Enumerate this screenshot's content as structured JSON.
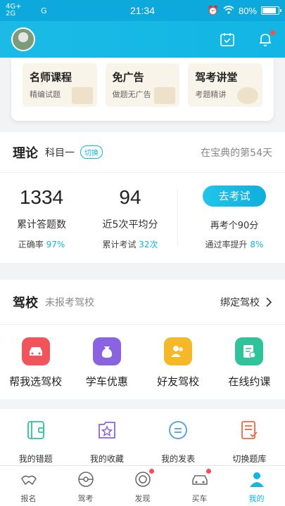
{
  "status": {
    "net1": "4G+",
    "net2": "2G",
    "net3": "G",
    "time": "21:34",
    "battery": "80%"
  },
  "promo": [
    {
      "title": "名师课程",
      "subtitle": "精编试题"
    },
    {
      "title": "免广告",
      "subtitle": "做题无广告"
    },
    {
      "title": "驾考讲堂",
      "subtitle": "考题精讲"
    }
  ],
  "theory": {
    "title": "理论",
    "subject": "科目一",
    "switch_label": "切换",
    "days_text": "在宝典的第54天",
    "total_answered": "1334",
    "total_label": "累计答题数",
    "accuracy_label": "正确率",
    "accuracy_value": "97%",
    "avg_score": "94",
    "avg_label": "近5次平均分",
    "exams_label": "累计考试",
    "exams_value": "32次",
    "exam_button": "去考试",
    "exam_note": "再考个90分",
    "pass_label": "通过率提升",
    "pass_value": "8%"
  },
  "school": {
    "title": "驾校",
    "status": "未报考驾校",
    "bind_label": "绑定驾校",
    "items": [
      {
        "label": "帮我选驾校",
        "color": "#f2545b"
      },
      {
        "label": "学车优惠",
        "color": "#8a63e0"
      },
      {
        "label": "好友驾校",
        "color": "#f5b829"
      },
      {
        "label": "在线约课",
        "color": "#2ec39a"
      }
    ]
  },
  "tools": [
    {
      "label": "我的错题",
      "color": "#2ec39a"
    },
    {
      "label": "我的收藏",
      "color": "#8a63e0"
    },
    {
      "label": "我的发表",
      "color": "#4a9ee8"
    },
    {
      "label": "切换题库",
      "color": "#f0683e"
    }
  ],
  "tabs": [
    {
      "label": "报名"
    },
    {
      "label": "驾考"
    },
    {
      "label": "发现"
    },
    {
      "label": "买车"
    },
    {
      "label": "我的"
    }
  ],
  "accent_color": "#12b5e3"
}
